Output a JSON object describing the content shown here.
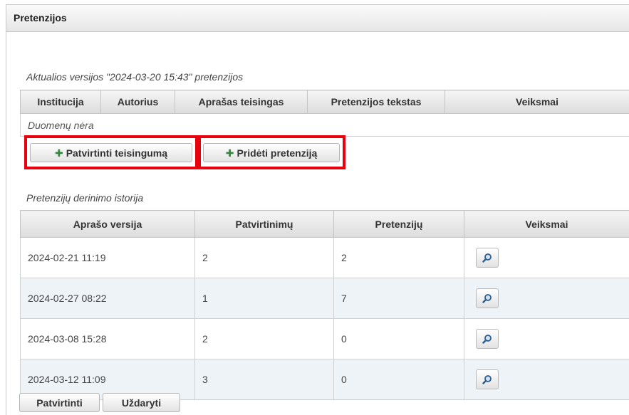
{
  "panel": {
    "title": "Pretenzijos"
  },
  "current": {
    "caption": "Aktualios versijos \"2024-03-20 15:43\" pretenzijos",
    "columns": [
      "Institucija",
      "Autorius",
      "Aprašas teisingas",
      "Pretenzijos tekstas",
      "Veiksmai"
    ],
    "empty_text": "Duomenų nėra"
  },
  "actions": {
    "confirm_label": "Patvirtinti teisingumą",
    "add_claim_label": "Pridėti pretenziją",
    "highlight_color": "#e8000d",
    "plus_icon": "plus-icon"
  },
  "history": {
    "caption": "Pretenzijų derinimo istorija",
    "columns": [
      "Aprašo versija",
      "Patvirtinimų",
      "Pretenzijų",
      "Veiksmai"
    ],
    "rows": [
      {
        "version": "2024-02-21 11:19",
        "confirmations": "2",
        "claims": "2"
      },
      {
        "version": "2024-02-27 08:22",
        "confirmations": "1",
        "claims": "7"
      },
      {
        "version": "2024-03-08 15:28",
        "confirmations": "2",
        "claims": "0"
      },
      {
        "version": "2024-03-12 11:09",
        "confirmations": "3",
        "claims": "0"
      }
    ],
    "view_icon": "magnifier-icon"
  },
  "footer": {
    "approve_label": "Patvirtinti",
    "close_label": "Uždaryti"
  }
}
